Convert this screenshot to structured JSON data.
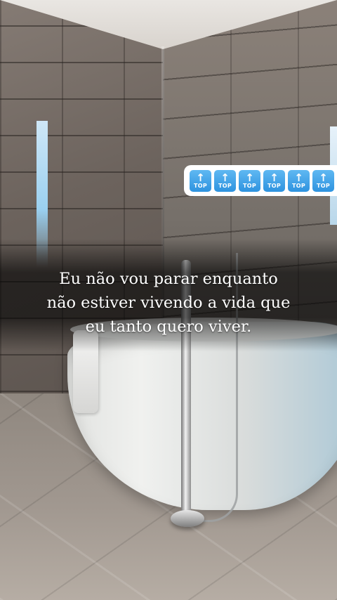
{
  "overlay": {
    "caption_lines": [
      "Eu não vou parar enquanto",
      "não estiver vivendo a vida que",
      "eu tanto quero viver."
    ]
  },
  "sticker": {
    "icon": "top-arrow-emoji",
    "badge_label": "TOP",
    "count": 6,
    "labels": [
      "TOP",
      "TOP",
      "TOP",
      "TOP",
      "TOP",
      "TOP"
    ],
    "color": "#2e93df"
  },
  "colors": {
    "caption_text": "#ffffff",
    "badge_background": "#ffffff"
  }
}
